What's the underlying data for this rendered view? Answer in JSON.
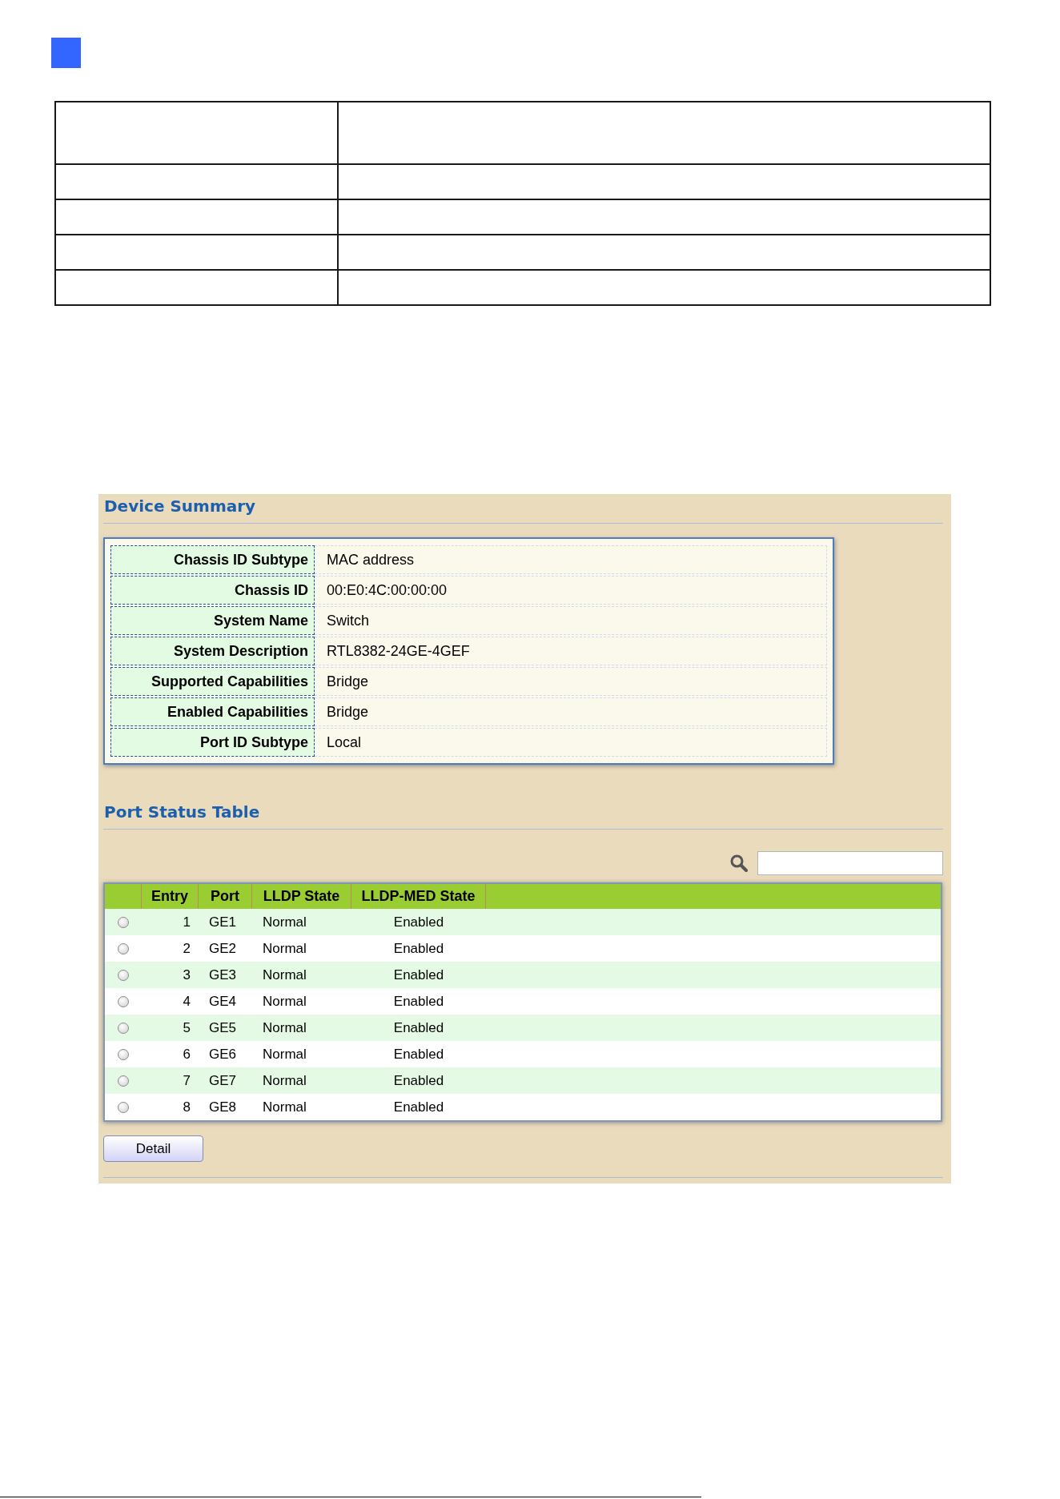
{
  "document_table": {
    "rows": [
      {
        "kind": "tall"
      },
      {
        "kind": "regular"
      },
      {
        "kind": "regular"
      },
      {
        "kind": "regular"
      },
      {
        "kind": "regular"
      }
    ]
  },
  "device_summary": {
    "title": "Device Summary",
    "fields": [
      {
        "label": "Chassis ID Subtype",
        "value": "MAC address"
      },
      {
        "label": "Chassis ID",
        "value": "00:E0:4C:00:00:00"
      },
      {
        "label": "System Name",
        "value": "Switch"
      },
      {
        "label": "System Description",
        "value": "RTL8382-24GE-4GEF"
      },
      {
        "label": "Supported Capabilities",
        "value": "Bridge"
      },
      {
        "label": "Enabled Capabilities",
        "value": "Bridge"
      },
      {
        "label": "Port ID Subtype",
        "value": "Local"
      }
    ]
  },
  "port_status_table": {
    "title": "Port Status Table",
    "columns": [
      "Entry",
      "Port",
      "LLDP State",
      "LLDP-MED State"
    ],
    "rows": [
      {
        "selected": false,
        "entry": "1",
        "port": "GE1",
        "lldp_state": "Normal",
        "lldp_med_state": "Enabled"
      },
      {
        "selected": false,
        "entry": "2",
        "port": "GE2",
        "lldp_state": "Normal",
        "lldp_med_state": "Enabled"
      },
      {
        "selected": false,
        "entry": "3",
        "port": "GE3",
        "lldp_state": "Normal",
        "lldp_med_state": "Enabled"
      },
      {
        "selected": false,
        "entry": "4",
        "port": "GE4",
        "lldp_state": "Normal",
        "lldp_med_state": "Enabled"
      },
      {
        "selected": false,
        "entry": "5",
        "port": "GE5",
        "lldp_state": "Normal",
        "lldp_med_state": "Enabled"
      },
      {
        "selected": false,
        "entry": "6",
        "port": "GE6",
        "lldp_state": "Normal",
        "lldp_med_state": "Enabled"
      },
      {
        "selected": false,
        "entry": "7",
        "port": "GE7",
        "lldp_state": "Normal",
        "lldp_med_state": "Enabled"
      },
      {
        "selected": false,
        "entry": "8",
        "port": "GE8",
        "lldp_state": "Normal",
        "lldp_med_state": "Enabled"
      }
    ]
  },
  "buttons": [
    "Detail"
  ]
}
